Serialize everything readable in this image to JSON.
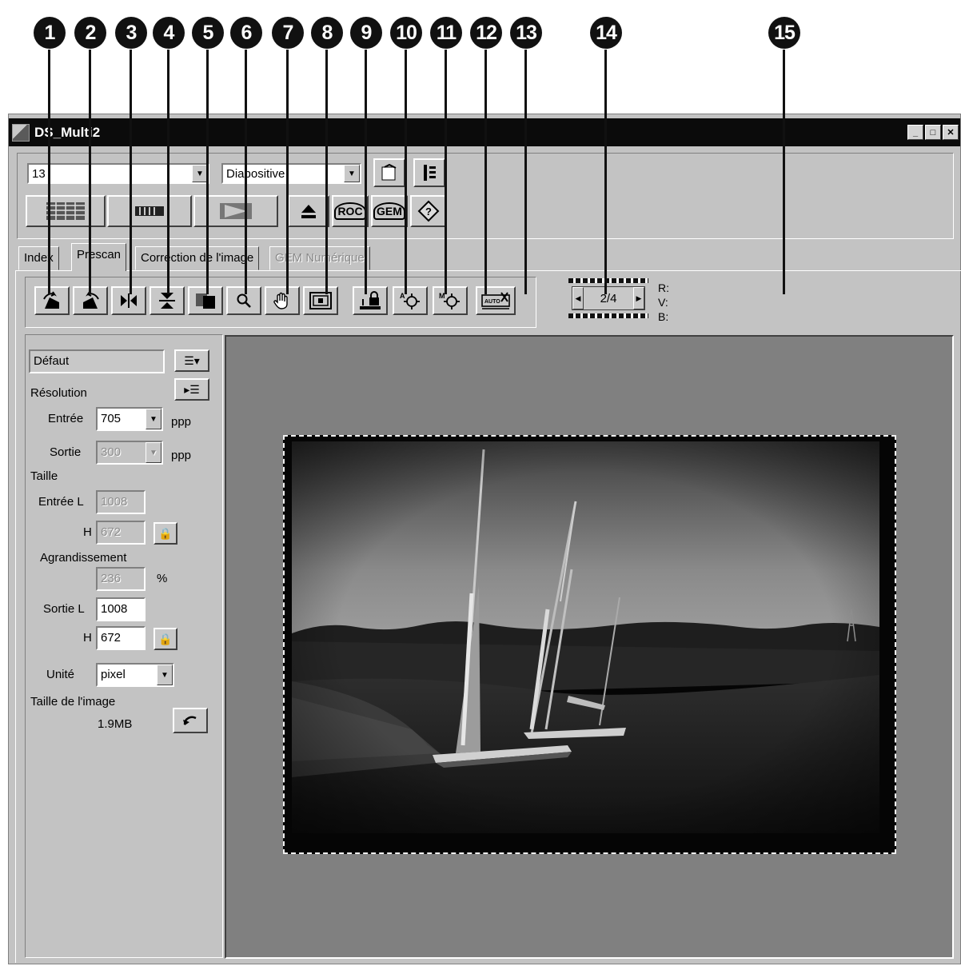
{
  "callouts": [
    "1",
    "2",
    "3",
    "4",
    "5",
    "6",
    "7",
    "8",
    "9",
    "10",
    "11",
    "12",
    "13",
    "14",
    "15"
  ],
  "window": {
    "title": "DS_Multi2",
    "controls": [
      "minimize-icon",
      "maximize-icon",
      "close-icon"
    ]
  },
  "top": {
    "frame_select": "13",
    "media_select": "Diapositive",
    "buttons": [
      "index-scan-icon",
      "prescan-strip-icon",
      "scan-play-icon",
      "eject-icon",
      "roc-icon",
      "gem-icon",
      "help-icon",
      "preferences-icon",
      "settings-icon"
    ],
    "roc_label": "ROC",
    "gem_label": "GEM"
  },
  "tabs": [
    {
      "label": "Index",
      "state": "normal"
    },
    {
      "label": "Prescan",
      "state": "active"
    },
    {
      "label": "Correction de l'image",
      "state": "normal"
    },
    {
      "label": "GEM Numérique",
      "state": "disabled"
    }
  ],
  "toolbar": {
    "buttons": [
      "rotate-left-icon",
      "rotate-right-icon",
      "flip-horizontal-icon",
      "flip-vertical-icon",
      "negative-positive-icon",
      "zoom-icon",
      "hand-pan-icon",
      "crop-frame-icon",
      "auto-crop-icon",
      "auto-focus-icon",
      "manual-focus-icon",
      "auto-exposure-icon"
    ],
    "frame_counter": "2/4",
    "rvb": [
      "R:",
      "V:",
      "B:"
    ]
  },
  "left_panel": {
    "preset": "Défaut",
    "resolution_label": "Résolution",
    "entree_label": "Entrée",
    "entree_value": "705",
    "ppp1": "ppp",
    "sortie_label": "Sortie",
    "sortie_value": "300",
    "ppp2": "ppp",
    "taille_label": "Taille",
    "entree_l_label": "Entrée L",
    "entree_l_value": "1008",
    "h1_label": "H",
    "h1_value": "672",
    "agrandissement_label": "Agrandissement",
    "agrandissement_value": "236",
    "percent": "%",
    "sortie_l_label": "Sortie L",
    "sortie_l_value": "1008",
    "h2_label": "H",
    "h2_value": "672",
    "unite_label": "Unité",
    "unite_value": "pixel",
    "taille_image_label": "Taille de l'image",
    "taille_image_value": "1.9MB"
  }
}
